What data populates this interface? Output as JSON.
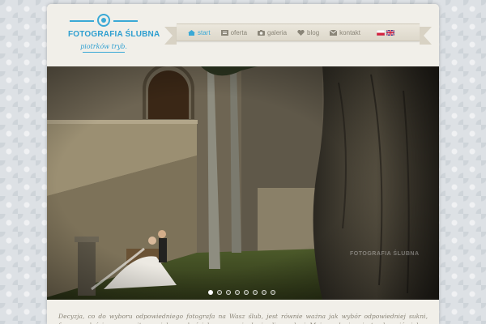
{
  "logo": {
    "title": "FOTOGRAFIA ŚLUBNA",
    "subtitle": "piotrków tryb.",
    "icon": "camera-aperture-icon"
  },
  "nav": {
    "items": [
      {
        "label": "start",
        "icon": "home-icon",
        "active": true
      },
      {
        "label": "oferta",
        "icon": "offer-icon",
        "active": false
      },
      {
        "label": "galeria",
        "icon": "camera-icon",
        "active": false
      },
      {
        "label": "blog",
        "icon": "heart-icon",
        "active": false
      },
      {
        "label": "kontakt",
        "icon": "envelope-icon",
        "active": false
      }
    ],
    "languages": [
      "pl",
      "en"
    ]
  },
  "slider": {
    "slide_count": 8,
    "active_slide": 1,
    "watermark": "FOTOGRAFIA ŚLUBNA"
  },
  "intro_text": "Decyzja, co do wyboru odpowiedniego fotografa na Wasz ślub, jest równie ważna jak wybór odpowiedniej sukni, fryzury, właściwego garnituru, pięknego kościoła czy oryginalnej sali weselnej. Moim zadaniem jest uchwycić piękno wszystkich tych",
  "colors": {
    "accent": "#3aa9d6",
    "nav_text": "#8a8578",
    "paper": "#f1efe9"
  }
}
